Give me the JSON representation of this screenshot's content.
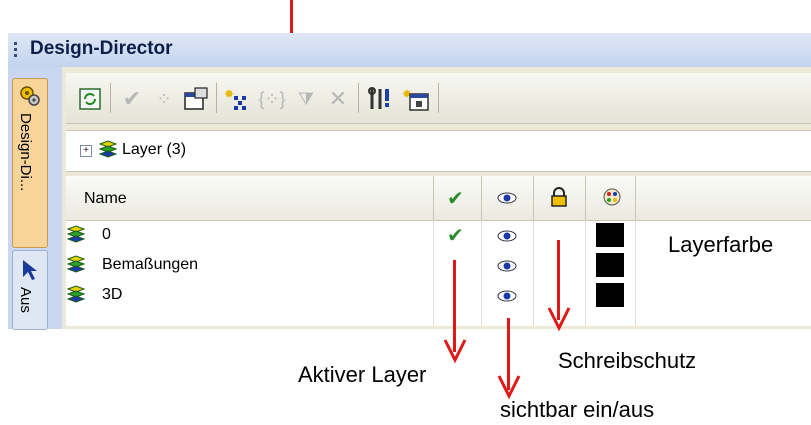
{
  "window": {
    "title": "Design-Director"
  },
  "side_tabs": [
    {
      "label": "Design-Di..."
    },
    {
      "label": "Aus"
    }
  ],
  "tree": {
    "label": "Layer (3)"
  },
  "table": {
    "header_name": "Name",
    "rows": [
      {
        "name": "0",
        "active": true,
        "visible": true
      },
      {
        "name": "Bemaßungen",
        "active": false,
        "visible": true
      },
      {
        "name": "3D",
        "active": false,
        "visible": true
      }
    ]
  },
  "annotations": {
    "color": "Layerfarbe",
    "active": "Aktiver Layer",
    "lock": "Schreibschutz",
    "visible": "sichtbar ein/aus"
  },
  "colors": {
    "arrow": "#e01818",
    "layer_color": "#000000"
  }
}
